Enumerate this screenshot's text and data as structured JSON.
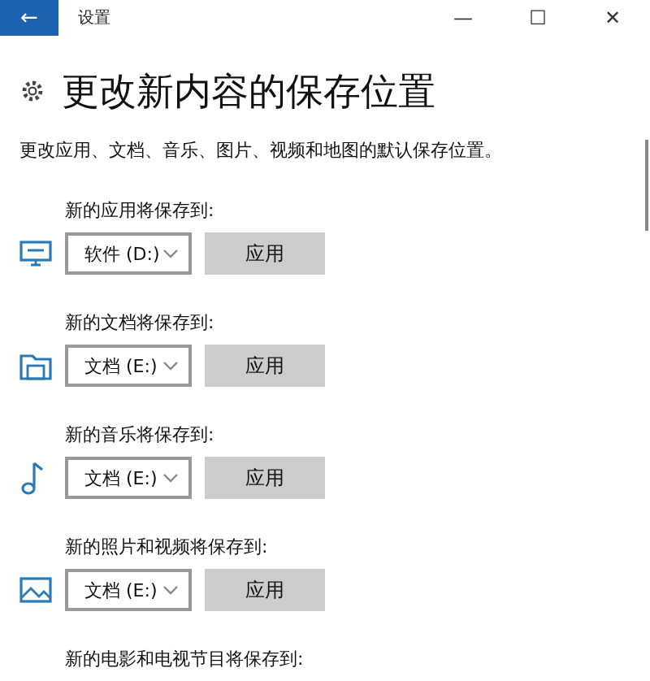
{
  "window": {
    "title": "设置",
    "back": "←",
    "minimize": "—",
    "maximize": "☐",
    "close": "✕"
  },
  "heading": "更改新内容的保存位置",
  "description": "更改应用、文档、音乐、图片、视频和地图的默认保存位置。",
  "sections": [
    {
      "kind": "apps",
      "label": "新的应用将保存到:",
      "drive": "软件 (D:)",
      "apply": "应用"
    },
    {
      "kind": "documents",
      "label": "新的文档将保存到:",
      "drive": "文档 (E:)",
      "apply": "应用"
    },
    {
      "kind": "music",
      "label": "新的音乐将保存到:",
      "drive": "文档 (E:)",
      "apply": "应用"
    },
    {
      "kind": "pictures",
      "label": "新的照片和视频将保存到:",
      "drive": "文档 (E:)",
      "apply": "应用"
    },
    {
      "label": "新的电影和电视节目将保存到:"
    }
  ]
}
